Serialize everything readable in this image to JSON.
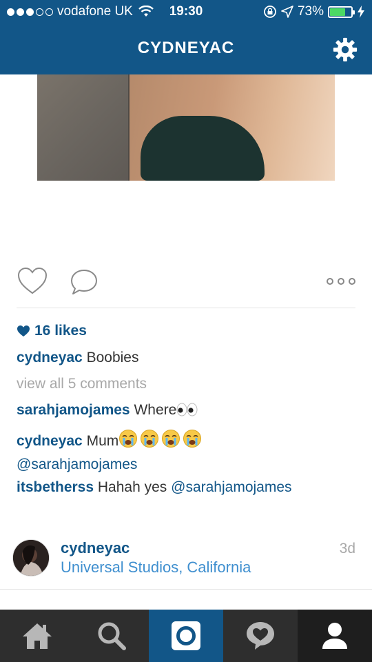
{
  "status_bar": {
    "carrier": "vodafone UK",
    "time": "19:30",
    "battery_percent": "73%",
    "battery_level": 0.73,
    "signal_bars_filled": 3,
    "signal_bars_total": 5
  },
  "header": {
    "title": "CYDNEYAC",
    "settings_icon": "gear-icon"
  },
  "post": {
    "likes": "16 likes",
    "caption": {
      "user": "cydneyac",
      "text": "Boobies"
    },
    "view_all_comments": "view all 5 comments",
    "comments": [
      {
        "user": "sarahjamojames",
        "text": "Where",
        "emoji": "eyes-emoji"
      },
      {
        "user": "cydneyac",
        "text": "Mum",
        "emoji": "crying-face-emoji",
        "mention": "@sarahjamojames"
      },
      {
        "user": "itsbetherss",
        "text": "Hahah yes",
        "mention": "@sarahjamojames"
      }
    ],
    "owner": {
      "username": "cydneyac",
      "location": "Universal Studios, California",
      "time_ago": "3d"
    }
  },
  "tab_bar": {
    "tabs": [
      "home-icon",
      "search-icon",
      "camera-icon",
      "activity-icon",
      "profile-icon"
    ],
    "active_tab": "profile-icon"
  },
  "colors": {
    "brand_blue": "#125688",
    "location_blue": "#3f8fcf",
    "tab_bar_bg": "#2e2e2e",
    "battery_green": "#4cd964"
  }
}
